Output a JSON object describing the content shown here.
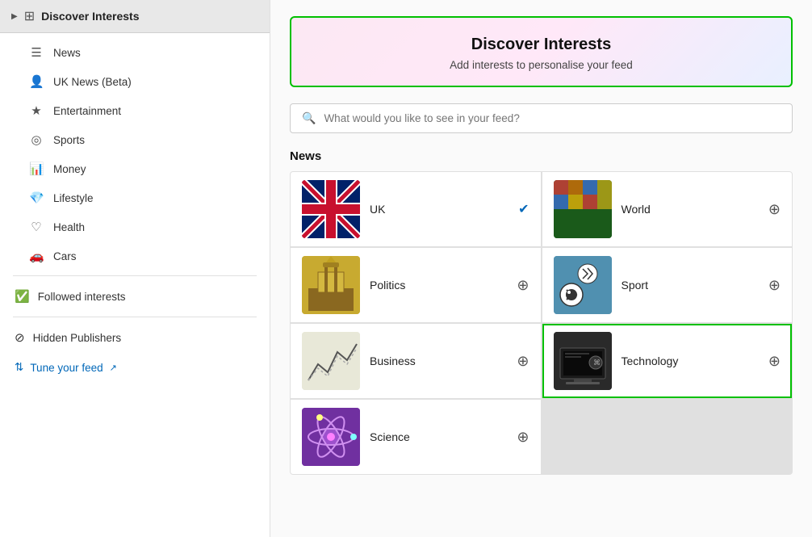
{
  "sidebar": {
    "header_label": "Discover Interests",
    "items": [
      {
        "id": "news",
        "label": "News",
        "icon": "☰"
      },
      {
        "id": "uk-news",
        "label": "UK News (Beta)",
        "icon": "👤"
      },
      {
        "id": "entertainment",
        "label": "Entertainment",
        "icon": "★"
      },
      {
        "id": "sports",
        "label": "Sports",
        "icon": "◎"
      },
      {
        "id": "money",
        "label": "Money",
        "icon": "📊"
      },
      {
        "id": "lifestyle",
        "label": "Lifestyle",
        "icon": "💎"
      },
      {
        "id": "health",
        "label": "Health",
        "icon": "♡"
      },
      {
        "id": "cars",
        "label": "Cars",
        "icon": "🚗"
      }
    ],
    "followed_label": "Followed interests",
    "hidden_label": "Hidden Publishers",
    "tune_label": "Tune your feed"
  },
  "main": {
    "discover_title": "Discover Interests",
    "discover_subtitle": "Add interests to personalise your feed",
    "search_placeholder": "What would you like to see in your feed?",
    "news_section_label": "News",
    "interests": [
      {
        "id": "uk",
        "label": "UK",
        "thumb_class": "thumb-uk",
        "thumb_text": "🇬🇧",
        "status": "checked",
        "highlighted": false
      },
      {
        "id": "world",
        "label": "World",
        "thumb_class": "thumb-world",
        "thumb_text": "🌍",
        "status": "add",
        "highlighted": false
      },
      {
        "id": "politics",
        "label": "Politics",
        "thumb_class": "thumb-politics",
        "thumb_text": "🏛",
        "status": "add",
        "highlighted": false
      },
      {
        "id": "sport",
        "label": "Sport",
        "thumb_class": "thumb-sport",
        "thumb_text": "⚽",
        "status": "add",
        "highlighted": false
      },
      {
        "id": "business",
        "label": "Business",
        "thumb_class": "thumb-business",
        "thumb_text": "📈",
        "status": "add",
        "highlighted": false
      },
      {
        "id": "technology",
        "label": "Technology",
        "thumb_class": "thumb-technology",
        "thumb_text": "💻",
        "status": "add",
        "highlighted": true
      },
      {
        "id": "science",
        "label": "Science",
        "thumb_class": "thumb-science",
        "thumb_text": "🔬",
        "status": "add",
        "highlighted": false
      }
    ]
  },
  "colors": {
    "accent_green": "#00c000",
    "accent_blue": "#0067b8"
  }
}
